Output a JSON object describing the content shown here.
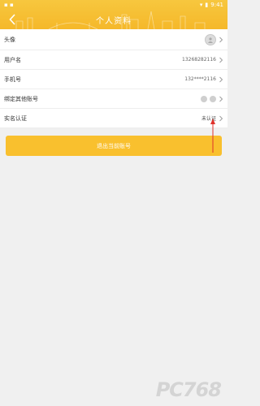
{
  "status_bar": {
    "time": "9:41"
  },
  "header": {
    "title": "个人资料",
    "back_icon": "chevron-left-icon"
  },
  "rows": [
    {
      "label": "头像",
      "value": ""
    },
    {
      "label": "用户名",
      "value": "13268282116"
    },
    {
      "label": "手机号",
      "value": "132****2116"
    },
    {
      "label": "绑定其他账号",
      "value": ""
    },
    {
      "label": "实名认证",
      "value": "未认证"
    }
  ],
  "logout": {
    "label": "退出当前账号"
  },
  "watermark": {
    "text": "PC768"
  },
  "colors": {
    "accent": "#f9c02e",
    "annotation": "#e0322c"
  }
}
